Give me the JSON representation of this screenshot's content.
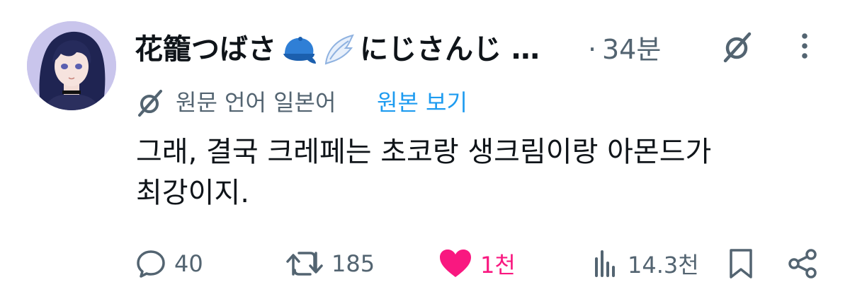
{
  "post": {
    "author": {
      "display_name": "花籠つばさ",
      "display_name_suffix": "にじさんじ …",
      "emoji": [
        "blue-cap-emoji",
        "wing-emoji"
      ]
    },
    "separator": "·",
    "time_ago": "34분",
    "translation": {
      "note": "원문 언어 일본어",
      "show_original_label": "원본 보기"
    },
    "text_line1": "그래, 결국 크레페는 초코랑 생크림이랑 아몬드가",
    "text_line2": "최강이지."
  },
  "actions": {
    "replies": "40",
    "reposts": "185",
    "likes": "1천",
    "views": "14.3천"
  },
  "colors": {
    "text_primary": "#0f1419",
    "text_secondary": "#536471",
    "link": "#1d9bf0",
    "like": "#f91880"
  },
  "icons": {
    "grok": "grok-icon",
    "more": "more-vertical-icon",
    "translate": "translate-icon",
    "reply": "reply-icon",
    "repost": "repost-icon",
    "like": "heart-icon",
    "views": "views-chart-icon",
    "bookmark": "bookmark-icon",
    "share": "share-icon"
  }
}
